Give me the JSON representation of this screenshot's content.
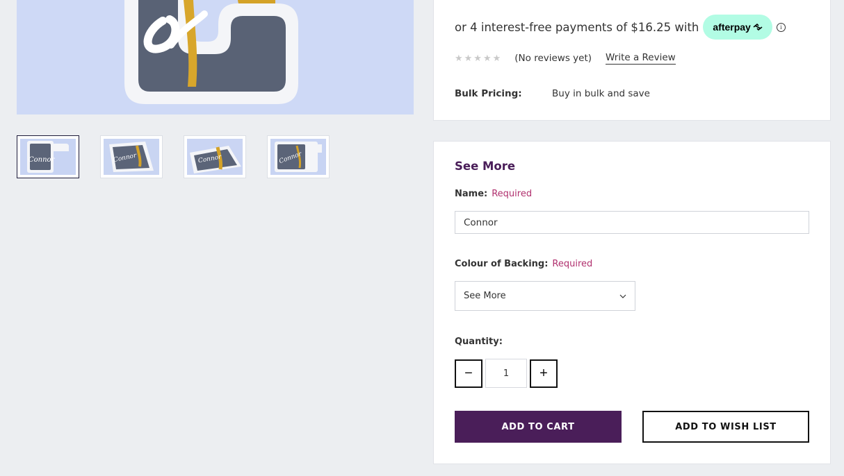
{
  "gallery": {
    "thumbnail_count": 4,
    "active_thumbnail_index": 0,
    "thumb_text": "Connor"
  },
  "pricing": {
    "afterpay_text": "or 4 interest-free payments of $16.25 with",
    "afterpay_brand": "afterpay",
    "afterpay_color": "#b2fce4",
    "info_icon": "i"
  },
  "reviews": {
    "stars": "★★★★★",
    "rating": 0,
    "no_reviews_text": "(No reviews yet)",
    "write_review_label": "Write a Review"
  },
  "bulk": {
    "label": "Bulk Pricing:",
    "value": "Buy in bulk and save"
  },
  "options": {
    "title": "See More",
    "name_label": "Name:",
    "name_required": "Required",
    "name_value": "Connor",
    "backing_label": "Colour of Backing:",
    "backing_required": "Required",
    "backing_selected": "See More",
    "quantity_label": "Quantity:",
    "quantity_value": "1",
    "minus_label": "−",
    "plus_label": "+"
  },
  "actions": {
    "add_to_cart": "ADD TO CART",
    "add_to_wishlist": "ADD TO WISH LIST"
  },
  "colors": {
    "brand_purple": "#4a1e59",
    "required_pink": "#b0306e",
    "page_bg": "#eceef1"
  }
}
